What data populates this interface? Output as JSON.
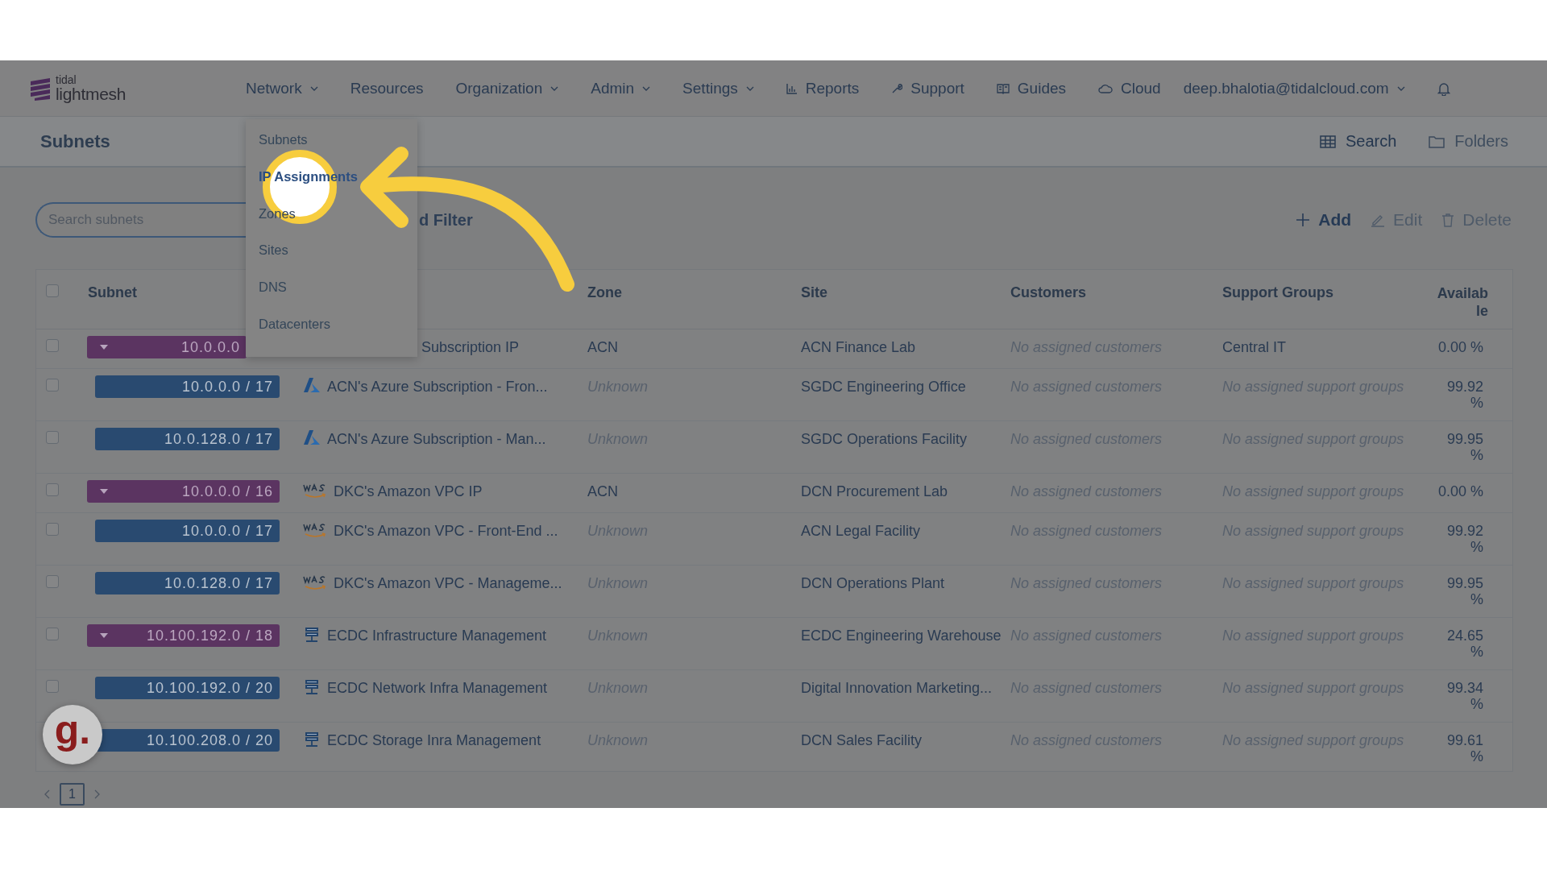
{
  "logo": {
    "small": "tidal",
    "name": "lightmesh"
  },
  "nav": [
    {
      "label": "Network",
      "caret": true
    },
    {
      "label": "Resources",
      "caret": false
    },
    {
      "label": "Organization",
      "caret": true
    },
    {
      "label": "Admin",
      "caret": true
    },
    {
      "label": "Settings",
      "caret": true
    },
    {
      "label": "Reports",
      "caret": false
    },
    {
      "label": "Support",
      "caret": false
    },
    {
      "label": "Guides",
      "caret": false
    },
    {
      "label": "Cloud",
      "caret": false
    }
  ],
  "user": {
    "email": "deep.bhalotia@tidalcloud.com"
  },
  "page": {
    "title": "Subnets",
    "actions": [
      {
        "label": "Search"
      },
      {
        "label": "Folders"
      }
    ]
  },
  "search": {
    "placeholder": "Search subnets"
  },
  "filter_button": {
    "label": "d Filter"
  },
  "toolbar": [
    {
      "label": "Add",
      "disabled": false
    },
    {
      "label": "Edit",
      "disabled": true
    },
    {
      "label": "Delete",
      "disabled": true
    }
  ],
  "table": {
    "select_all": {
      "checked": false
    },
    "columns": [
      "Subnet",
      "Zone",
      "Site",
      "Customers",
      "Support Groups",
      "Available"
    ],
    "rows": [
      {
        "checked": false,
        "kind": "parent",
        "subnet": "10.0.0.0",
        "name": "Subscription IP",
        "zone": {
          "text": "ACN",
          "muted": false
        },
        "site": "ACN Finance Lab",
        "customers": {
          "text": "No assigned customers",
          "muted": true
        },
        "support": {
          "text": "Central IT",
          "muted": false
        },
        "available": "0.00 %"
      },
      {
        "checked": false,
        "kind": "child",
        "subnet": "10.0.0.0 / 17",
        "name": "ACN's Azure Subscription - Fron...",
        "zone": {
          "text": "Unknown",
          "muted": true
        },
        "site": "SGDC Engineering Office",
        "customers": {
          "text": "No assigned customers",
          "muted": true
        },
        "support": {
          "text": "No assigned support groups",
          "muted": true
        },
        "available": "99.92 %"
      },
      {
        "checked": false,
        "kind": "child",
        "subnet": "10.0.128.0 / 17",
        "name": "ACN's Azure Subscription - Man...",
        "zone": {
          "text": "Unknown",
          "muted": true
        },
        "site": "SGDC Operations Facility",
        "customers": {
          "text": "No assigned customers",
          "muted": true
        },
        "support": {
          "text": "No assigned support groups",
          "muted": true
        },
        "available": "99.95 %"
      },
      {
        "checked": false,
        "kind": "parent",
        "subnet": "10.0.0.0 / 16",
        "name": "DKC's Amazon VPC IP",
        "zone": {
          "text": "ACN",
          "muted": false
        },
        "site": "DCN Procurement Lab",
        "customers": {
          "text": "No assigned customers",
          "muted": true
        },
        "support": {
          "text": "No assigned support groups",
          "muted": true
        },
        "available": "0.00 %"
      },
      {
        "checked": false,
        "kind": "child",
        "subnet": "10.0.0.0 / 17",
        "name": "DKC's Amazon VPC - Front-End ...",
        "zone": {
          "text": "Unknown",
          "muted": true
        },
        "site": "ACN Legal Facility",
        "customers": {
          "text": "No assigned customers",
          "muted": true
        },
        "support": {
          "text": "No assigned support groups",
          "muted": true
        },
        "available": "99.92 %"
      },
      {
        "checked": false,
        "kind": "child",
        "subnet": "10.0.128.0 / 17",
        "name": "DKC's Amazon VPC - Manageme...",
        "zone": {
          "text": "Unknown",
          "muted": true
        },
        "site": "DCN Operations Plant",
        "customers": {
          "text": "No assigned customers",
          "muted": true
        },
        "support": {
          "text": "No assigned support groups",
          "muted": true
        },
        "available": "99.95 %"
      },
      {
        "checked": false,
        "kind": "parent",
        "subnet": "10.100.192.0 / 18",
        "name": "ECDC Infrastructure Management",
        "zone": {
          "text": "Unknown",
          "muted": true
        },
        "site": "ECDC Engineering Warehouse",
        "customers": {
          "text": "No assigned customers",
          "muted": true
        },
        "support": {
          "text": "No assigned support groups",
          "muted": true
        },
        "available": "24.65 %"
      },
      {
        "checked": false,
        "kind": "child",
        "subnet": "10.100.192.0 / 20",
        "name": "ECDC Network Infra Management",
        "zone": {
          "text": "Unknown",
          "muted": true
        },
        "site": "Digital Innovation Marketing...",
        "customers": {
          "text": "No assigned customers",
          "muted": true
        },
        "support": {
          "text": "No assigned support groups",
          "muted": true
        },
        "available": "99.34 %"
      },
      {
        "kind": "child",
        "subnet": "10.100.208.0 / 20",
        "name": "ECDC Storage Inra Management",
        "zone": {
          "text": "Unknown",
          "muted": true
        },
        "site": "DCN Sales Facility",
        "customers": {
          "text": "No assigned customers",
          "muted": true
        },
        "support": {
          "text": "No assigned support groups",
          "muted": true
        },
        "available": "99.61 %"
      }
    ]
  },
  "pagination": {
    "pages": [
      {
        "label": "1",
        "selected": true
      }
    ]
  },
  "menu": {
    "items": [
      {
        "label": "Subnets",
        "selected": false
      },
      {
        "label": "IP Assignments",
        "selected": true
      },
      {
        "label": "Zones",
        "selected": false
      },
      {
        "label": "Sites",
        "selected": false
      },
      {
        "label": "DNS",
        "selected": false
      },
      {
        "label": "Datacenters",
        "selected": false
      }
    ]
  },
  "widget": {
    "label": "g."
  }
}
